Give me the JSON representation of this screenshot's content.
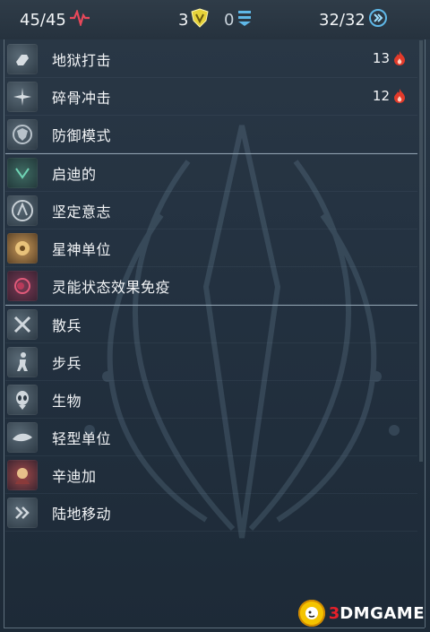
{
  "stats": {
    "health": "45/45",
    "armor": "3",
    "shields": "0",
    "energy": "32/32"
  },
  "abilities": [
    {
      "label": "地狱打击",
      "cost": "13",
      "icon": "fist-icon"
    },
    {
      "label": "碎骨冲击",
      "cost": "12",
      "icon": "shatter-icon"
    },
    {
      "label": "防御模式",
      "icon": "defense-shield-icon"
    }
  ],
  "traits": [
    {
      "label": "启迪的",
      "icon": "enlightened-icon"
    },
    {
      "label": "坚定意志",
      "icon": "resolve-icon"
    },
    {
      "label": "星神单位",
      "icon": "star-god-icon"
    },
    {
      "label": "灵能状态效果免疫",
      "icon": "psionic-immunity-icon"
    }
  ],
  "tags": [
    {
      "label": "散兵",
      "icon": "crossed-swords-icon"
    },
    {
      "label": "步兵",
      "icon": "infantry-icon"
    },
    {
      "label": "生物",
      "icon": "alien-head-icon"
    },
    {
      "label": "轻型单位",
      "icon": "light-unit-icon"
    },
    {
      "label": "辛迪加",
      "icon": "syndicate-icon"
    },
    {
      "label": "陆地移动",
      "icon": "ground-movement-icon"
    }
  ],
  "colors": {
    "health_accent": "#e8485a",
    "armor_accent": "#e6d23a",
    "shield_accent": "#5fb8e8",
    "cost_flame": "#e23a2a"
  },
  "watermark": {
    "number": "3",
    "text": "DMGAME"
  }
}
